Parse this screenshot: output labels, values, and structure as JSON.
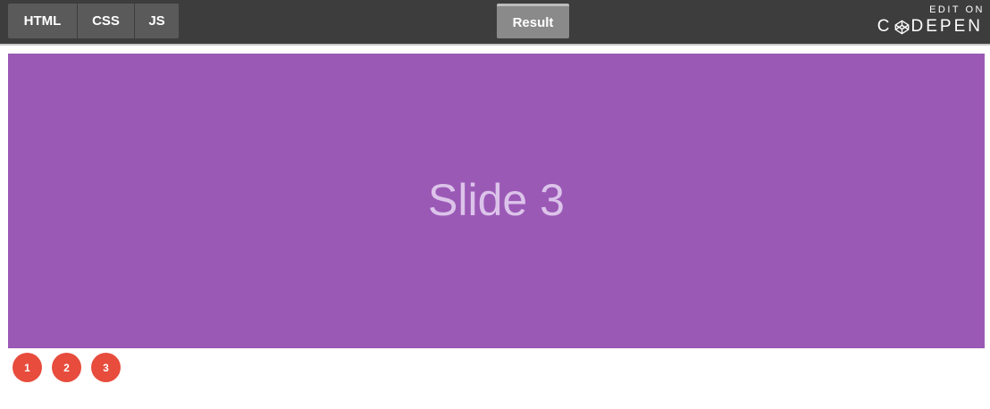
{
  "toolbar": {
    "tabs": [
      {
        "label": "HTML"
      },
      {
        "label": "CSS"
      },
      {
        "label": "JS"
      }
    ],
    "result_label": "Result",
    "edit_on_label": "EDIT ON",
    "codepen_prefix": "C",
    "codepen_suffix": "DEPEN"
  },
  "slider": {
    "current_slide_text": "Slide 3",
    "background_color": "#9b59b6",
    "pagination": [
      {
        "label": "1"
      },
      {
        "label": "2"
      },
      {
        "label": "3"
      }
    ],
    "pagination_color": "#e74c3c"
  }
}
